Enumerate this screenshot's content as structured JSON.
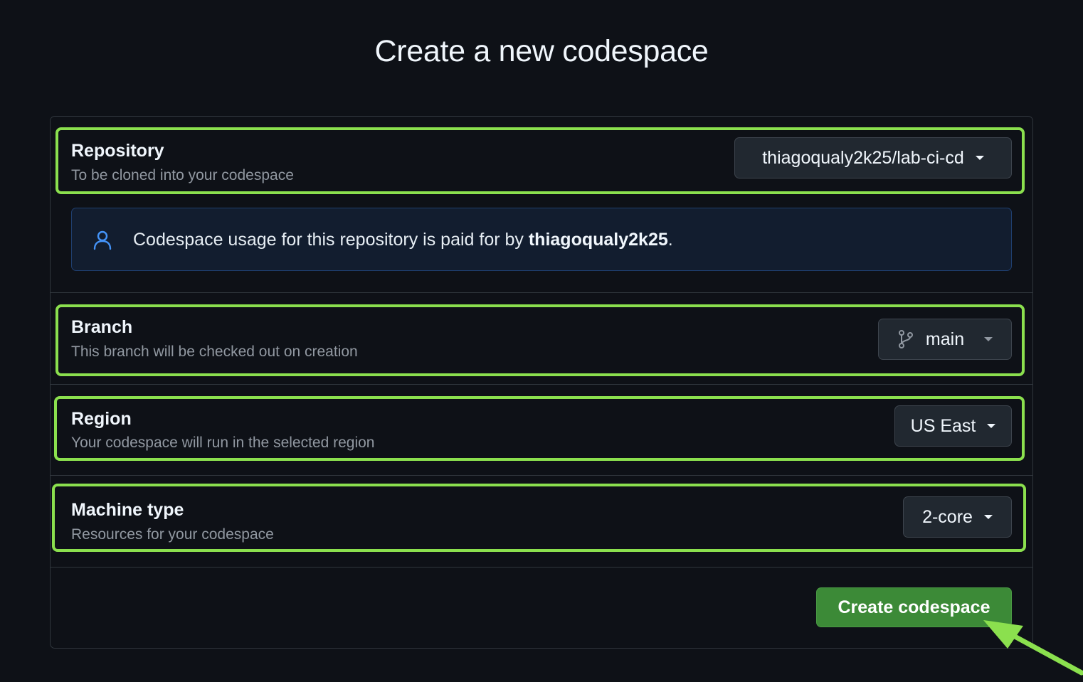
{
  "page": {
    "title": "Create a new codespace"
  },
  "repository": {
    "title": "Repository",
    "description": "To be cloned into your codespace",
    "selected": "thiagoqualy2k25/lab-ci-cd"
  },
  "notice": {
    "prefix": "Codespace usage for this repository is paid for by ",
    "owner": "thiagoqualy2k25",
    "suffix": ".",
    "icon": "person-icon"
  },
  "branch": {
    "title": "Branch",
    "description": "This branch will be checked out on creation",
    "selected": "main",
    "icon": "git-branch-icon"
  },
  "region": {
    "title": "Region",
    "description": "Your codespace will run in the selected region",
    "selected": "US East"
  },
  "machine": {
    "title": "Machine type",
    "description": "Resources for your codespace",
    "selected": "2-core"
  },
  "actions": {
    "create_label": "Create codespace"
  },
  "colors": {
    "highlight": "#8be04e",
    "primary_button": "#3c8a37",
    "background": "#0e1117",
    "notice_background": "#121d2f"
  }
}
